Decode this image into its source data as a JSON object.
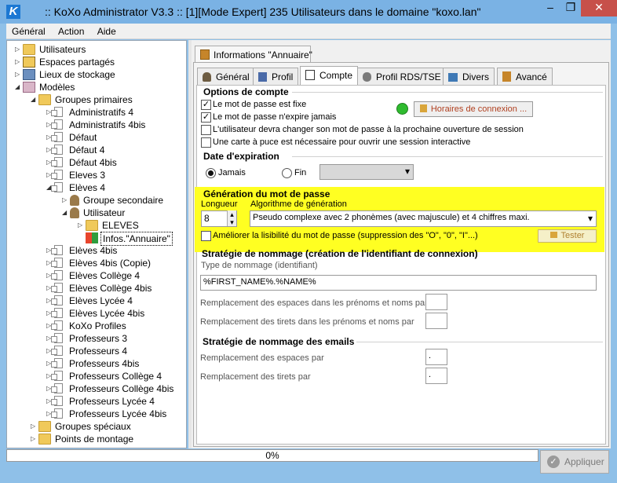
{
  "window": {
    "title": ":: KoXo Administrator V3.3 :: [1][Mode Expert] 235 Utilisateurs dans le domaine \"koxo.lan\"",
    "app_icon_letter": "K",
    "min_glyph": "–",
    "max_glyph": "❐",
    "close_glyph": "✕"
  },
  "menu": [
    {
      "label": "Général",
      "underline": "G"
    },
    {
      "label": "Action",
      "underline": "A"
    },
    {
      "label": "Aide",
      "underline": "A"
    }
  ],
  "tree": [
    {
      "label": "Utilisateurs",
      "icon": "folder-icon",
      "expander": "▷"
    },
    {
      "label": "Espaces partagés",
      "icon": "share-icon",
      "expander": "▷"
    },
    {
      "label": "Lieux de stockage",
      "icon": "storage-icon",
      "expander": "▷"
    },
    {
      "label": "Modèles",
      "icon": "templates-icon",
      "expander": "◢"
    },
    {
      "label": "Groupes primaires",
      "icon": "folder-icon",
      "expander": "◢"
    },
    {
      "label": "Administratifs 4",
      "icon": "document-icon",
      "expander": "▷"
    },
    {
      "label": "Administratifs 4bis",
      "icon": "document-icon",
      "expander": "▷"
    },
    {
      "label": "Défaut",
      "icon": "document-icon",
      "expander": "▷"
    },
    {
      "label": "Défaut 4",
      "icon": "document-icon",
      "expander": "▷"
    },
    {
      "label": "Défaut 4bis",
      "icon": "document-icon",
      "expander": "▷"
    },
    {
      "label": "Eleves 3",
      "icon": "document-icon",
      "expander": "▷"
    },
    {
      "label": "Elèves 4",
      "icon": "document-icon",
      "expander": "◢"
    },
    {
      "label": "Groupe secondaire",
      "icon": "group-icon",
      "expander": "▷"
    },
    {
      "label": "Utilisateur",
      "icon": "user-icon",
      "expander": "◢"
    },
    {
      "label": "ELEVES",
      "icon": "folder-icon",
      "expander": "▷"
    },
    {
      "label": "Infos.\"Annuaire\"",
      "icon": "directory-info-icon",
      "expander": ""
    },
    {
      "label": "Elèves 4bis",
      "icon": "document-icon",
      "expander": "▷"
    },
    {
      "label": "Elèves 4bis (Copie)",
      "icon": "document-icon",
      "expander": "▷"
    },
    {
      "label": "Elèves Collège 4",
      "icon": "document-icon",
      "expander": "▷"
    },
    {
      "label": "Elèves Collège 4bis",
      "icon": "document-icon",
      "expander": "▷"
    },
    {
      "label": "Elèves Lycée 4",
      "icon": "document-icon",
      "expander": "▷"
    },
    {
      "label": "Elèves Lycée 4bis",
      "icon": "document-icon",
      "expander": "▷"
    },
    {
      "label": "KoXo Profiles",
      "icon": "document-icon",
      "expander": "▷"
    },
    {
      "label": "Professeurs 3",
      "icon": "document-icon",
      "expander": "▷"
    },
    {
      "label": "Professeurs 4",
      "icon": "document-icon",
      "expander": "▷"
    },
    {
      "label": "Professeurs 4bis",
      "icon": "document-icon",
      "expander": "▷"
    },
    {
      "label": "Professeurs Collège 4",
      "icon": "document-icon",
      "expander": "▷"
    },
    {
      "label": "Professeurs Collège 4bis",
      "icon": "document-icon",
      "expander": "▷"
    },
    {
      "label": "Professeurs Lycée 4",
      "icon": "document-icon",
      "expander": "▷"
    },
    {
      "label": "Professeurs Lycée 4bis",
      "icon": "document-icon",
      "expander": "▷"
    },
    {
      "label": "Groupes spéciaux",
      "icon": "folder-icon",
      "expander": "▷"
    },
    {
      "label": "Points de montage",
      "icon": "folder-icon",
      "expander": "▷"
    }
  ],
  "outer_tab": {
    "label": "Informations \"Annuaire\""
  },
  "inner_tabs": [
    {
      "label": "Général",
      "icon": "person-icon"
    },
    {
      "label": "Profil",
      "icon": "profile-icon"
    },
    {
      "label": "Compte",
      "icon": "account-icon"
    },
    {
      "label": "Profil RDS/TSE",
      "icon": "rds-profile-icon"
    },
    {
      "label": "Divers",
      "icon": "misc-icon"
    },
    {
      "label": "Avancé",
      "icon": "advanced-icon"
    }
  ],
  "account_options": {
    "title": "Options de compte",
    "items": [
      {
        "label": "Le mot de passe est fixe",
        "checked": true
      },
      {
        "label": "Le mot de passe n'expire jamais",
        "checked": true
      },
      {
        "label": "L'utilisateur devra changer son mot de passe à la prochaine ouverture de session",
        "checked": false
      },
      {
        "label": "Une carte à puce est nécessaire pour ouvrir une session interactive",
        "checked": false
      }
    ],
    "hours_button": "Horaires de connexion ...",
    "check_glyph": "✓"
  },
  "expiration": {
    "title": "Date d'expiration",
    "never_label": "Jamais",
    "end_label": "Fin",
    "date_value": "",
    "dropdown_glyph": "▾"
  },
  "password_generation": {
    "title": "Génération du mot de passe",
    "length_label": "Longueur",
    "length_value": "8",
    "algo_label": "Algorithme de génération",
    "algo_value": "Pseudo complexe avec 2 phonèmes (avec majuscule) et 4 chiffres maxi.",
    "readability_label": "Améliorer la lisibilité du mot de passe (suppression des \"O\", \"0\", \"I\"...)",
    "test_button": "Tester",
    "spin_up": "▴",
    "spin_down": "▾",
    "highlight_color": "#ffff22"
  },
  "naming": {
    "title": "Stratégie de nommage (création de l'identifiant de connexion)",
    "type_label": "Type de nommage (identifiant)",
    "type_value": "%FIRST_NAME%.%NAME%",
    "spaces_label": "Remplacement des espaces dans les prénoms et noms par",
    "spaces_value": "",
    "dashes_label": "Remplacement des tirets dans les prénoms et noms par",
    "dashes_value": ""
  },
  "email_naming": {
    "title": "Stratégie de nommage des emails",
    "spaces_label": "Remplacement des espaces  par",
    "spaces_value": ".",
    "dashes_label": "Remplacement des tirets par",
    "dashes_value": "."
  },
  "status": {
    "progress_text": "0%",
    "progress": 0
  },
  "apply_button": {
    "label": "Appliquer",
    "glyph": "✓"
  },
  "colors": {
    "titlebar": "#7ab2e4",
    "close": "#c7504a",
    "highlight": "#ffff22"
  }
}
